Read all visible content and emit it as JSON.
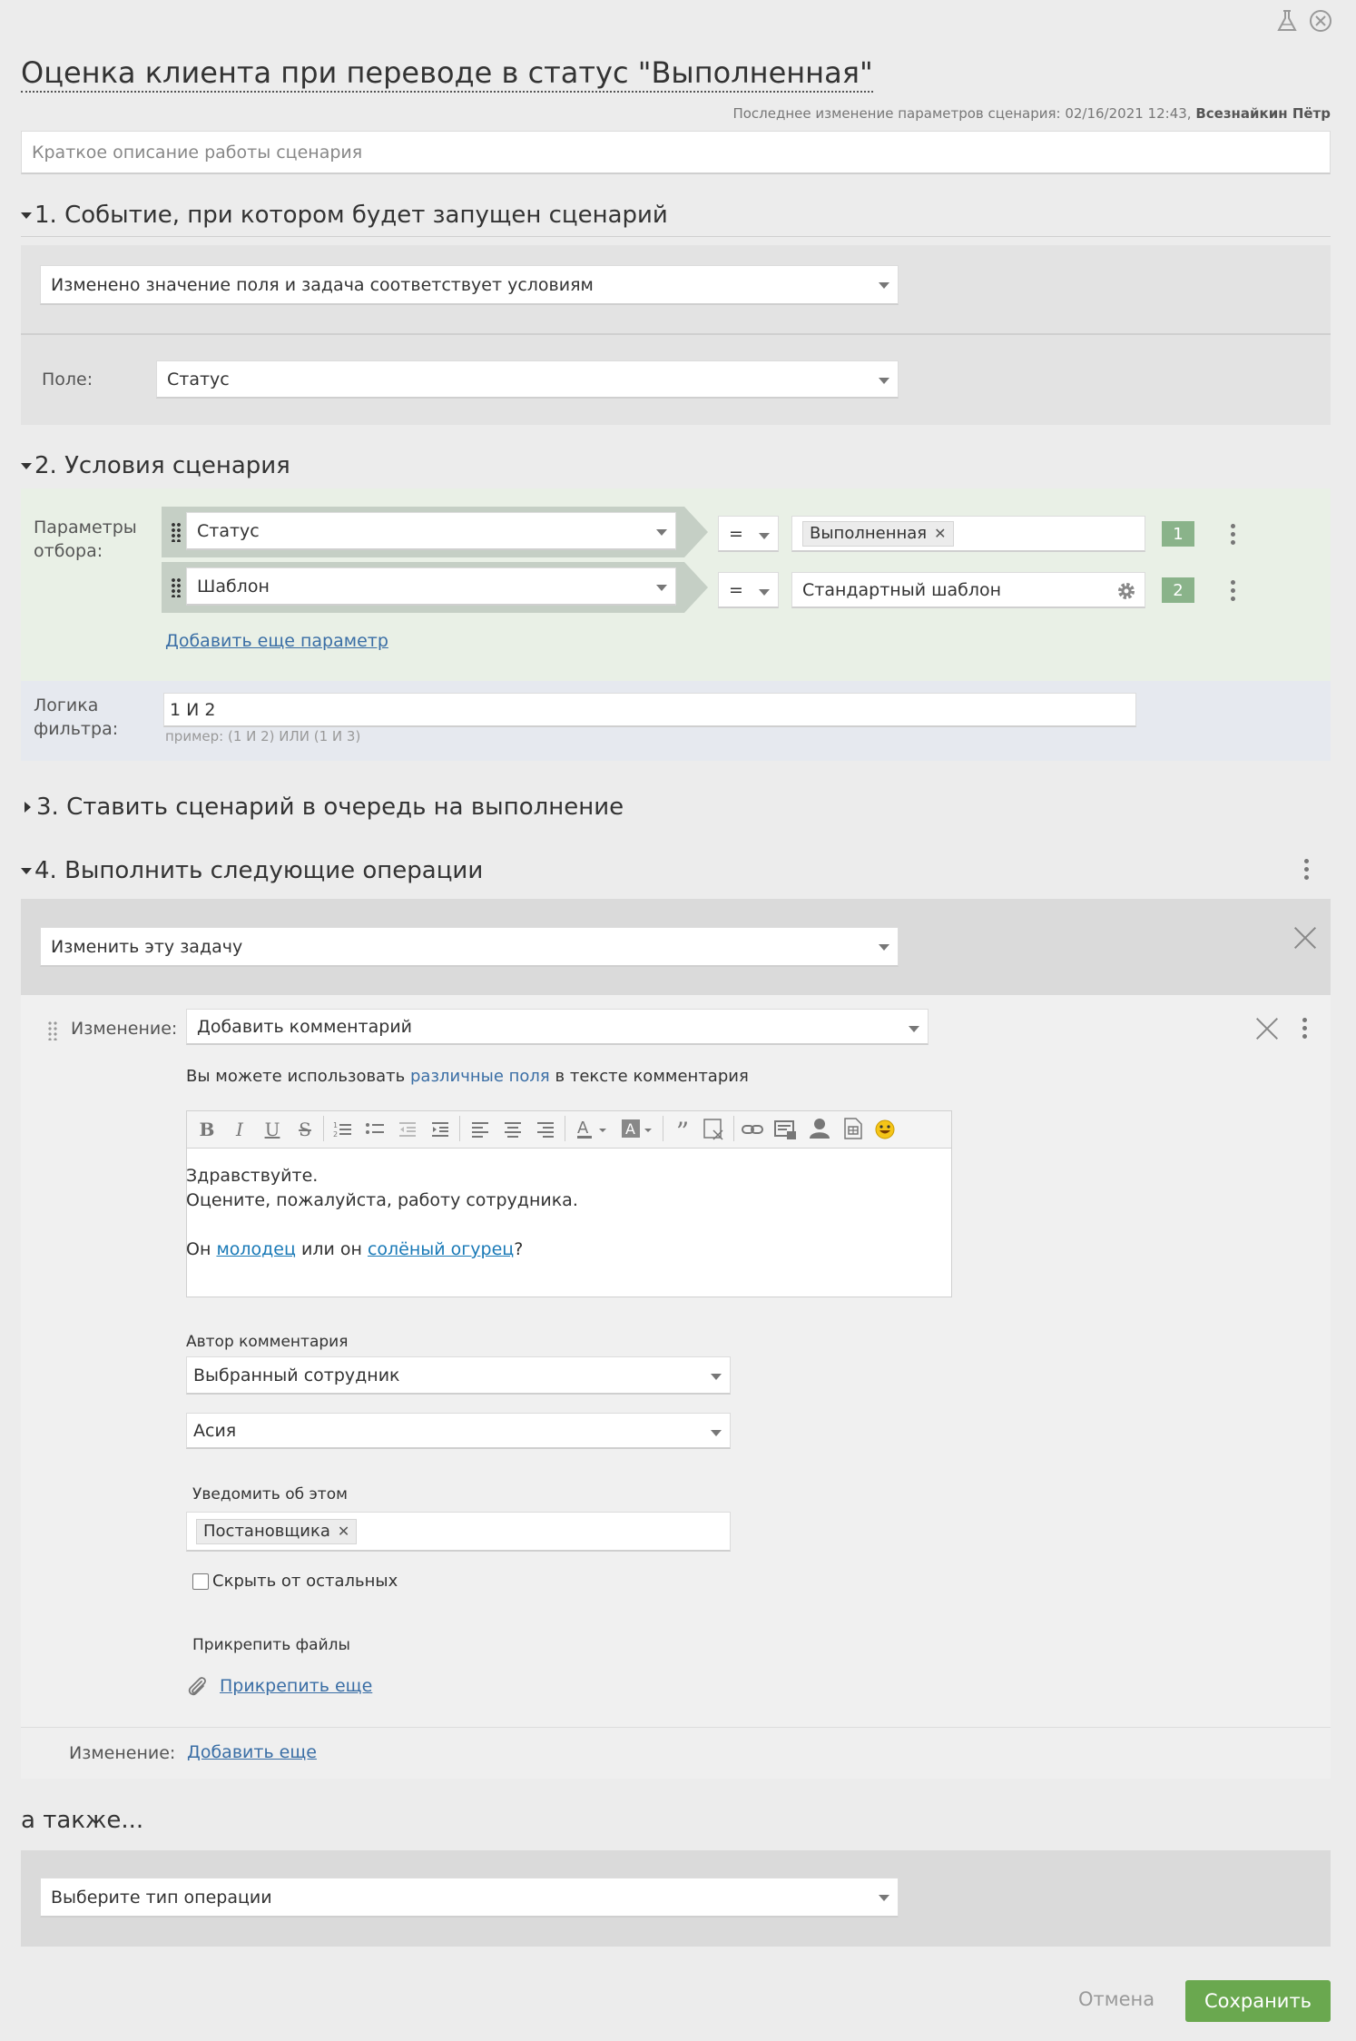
{
  "header": {
    "title": "Оценка клиента при переводе в статус \"Выполненная\"",
    "last_change_prefix": "Последнее изменение параметров сценария: 02/16/2021 12:43,",
    "last_change_author": "Всезнайкин Пётр",
    "description_placeholder": "Краткое описание работы сценария"
  },
  "section1": {
    "title": "1. Событие, при котором будет запущен сценарий",
    "event_value": "Изменено значение поля и задача соответствует условиям",
    "field_label": "Поле:",
    "field_value": "Статус"
  },
  "section2": {
    "title": "2. Условия сценария",
    "params_label_line1": "Параметры",
    "params_label_line2": "отбора:",
    "conditions": [
      {
        "field": "Статус",
        "operator": "=",
        "value": "Выполненная",
        "number": "1"
      },
      {
        "field": "Шаблон",
        "operator": "=",
        "value": "Стандартный шаблон",
        "number": "2"
      }
    ],
    "add_param_link": "Добавить еще параметр",
    "logic_label_line1": "Логика",
    "logic_label_line2": "фильтра:",
    "logic_value": "1 И 2",
    "logic_hint": "пример: (1 И 2) ИЛИ (1 И 3)"
  },
  "section3": {
    "title": "3. Ставить сценарий в очередь на выполнение"
  },
  "section4": {
    "title": "4. Выполнить следующие операции",
    "operation_value": "Изменить эту задачу",
    "change_label": "Изменение:",
    "change_value": "Добавить комментарий",
    "hint_prefix": "Вы можете использовать",
    "hint_link": "различные поля",
    "hint_suffix": "в тексте комментария",
    "editor": {
      "line1": "Здравствуйте.",
      "line2": "Оцените, пожалуйста, работу сотрудника.",
      "line3_prefix": "Он",
      "line3_link1": "молодец",
      "line3_middle": "или он",
      "line3_link2": "солёный огурец",
      "line3_suffix": "?"
    },
    "author_label": "Автор комментария",
    "author_mode": "Выбранный сотрудник",
    "author_value": "Асия",
    "notify_label": "Уведомить об этом",
    "notify_tag": "Постановщика",
    "hide_label": "Скрыть от остальных",
    "attach_label": "Прикрепить файлы",
    "attach_link": "Прикрепить еще",
    "change_label2": "Изменение:",
    "add_more_link": "Добавить еще"
  },
  "also": {
    "title": "а также...",
    "select_placeholder": "Выберите тип операции"
  },
  "footer": {
    "cancel": "Отмена",
    "save": "Сохранить"
  },
  "colors": {
    "accent_green": "#6aa84f",
    "link_blue": "#3a6ea5",
    "badge_green": "#8ab38a",
    "conditions_bg": "#e9f0e6",
    "logic_bg": "#e6e9ef"
  }
}
